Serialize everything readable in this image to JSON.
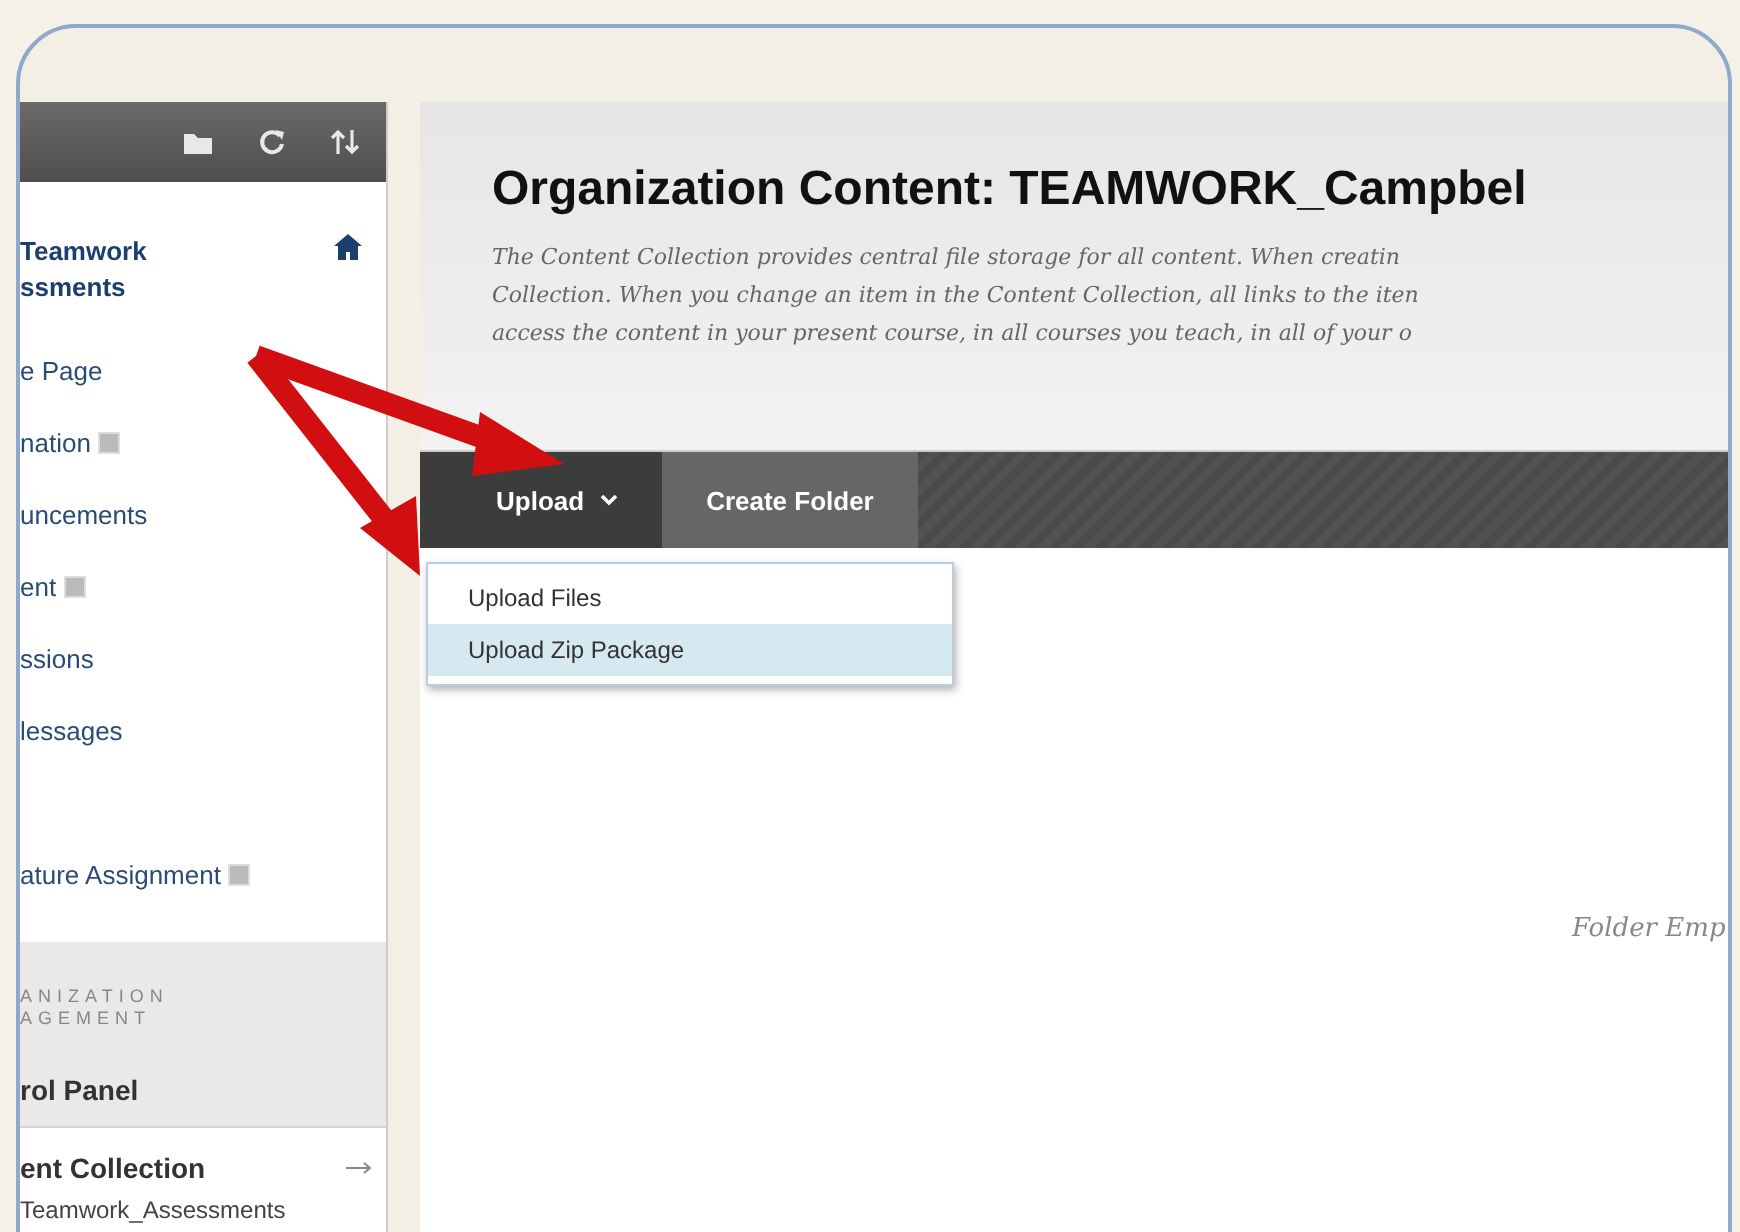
{
  "sidebar": {
    "course_title_lines": [
      "Teamwork",
      "ssments"
    ],
    "items": [
      {
        "label": "e Page",
        "badge": false
      },
      {
        "label": "nation",
        "badge": true
      },
      {
        "label": "uncements",
        "badge": false
      },
      {
        "label": "ent",
        "badge": true
      },
      {
        "label": "ssions",
        "badge": false
      },
      {
        "label": "lessages",
        "badge": false
      },
      {
        "label": "ature Assignment",
        "badge": true
      }
    ],
    "management": {
      "heading_lines": [
        "ANIZATION",
        "AGEMENT"
      ],
      "control_panel": "rol Panel",
      "section": "ent Collection",
      "sub_item": "Teamwork_Assessments"
    }
  },
  "main": {
    "title": "Organization Content: TEAMWORK_Campbel",
    "description_lines": [
      "The Content Collection provides central file storage for all content. When creatin",
      "Collection. When you change an item in the Content Collection, all links to the iten",
      "access the content in your present course, in all courses you teach, in all of your o"
    ],
    "actions": [
      {
        "label": "Upload",
        "kind": "menu",
        "selected": true
      },
      {
        "label": "Create Folder",
        "kind": "button",
        "selected": false
      }
    ],
    "dropdown": [
      {
        "label": "Upload Files",
        "selected": false
      },
      {
        "label": "Upload Zip Package",
        "selected": true
      }
    ],
    "empty_text": "Folder Emp"
  }
}
